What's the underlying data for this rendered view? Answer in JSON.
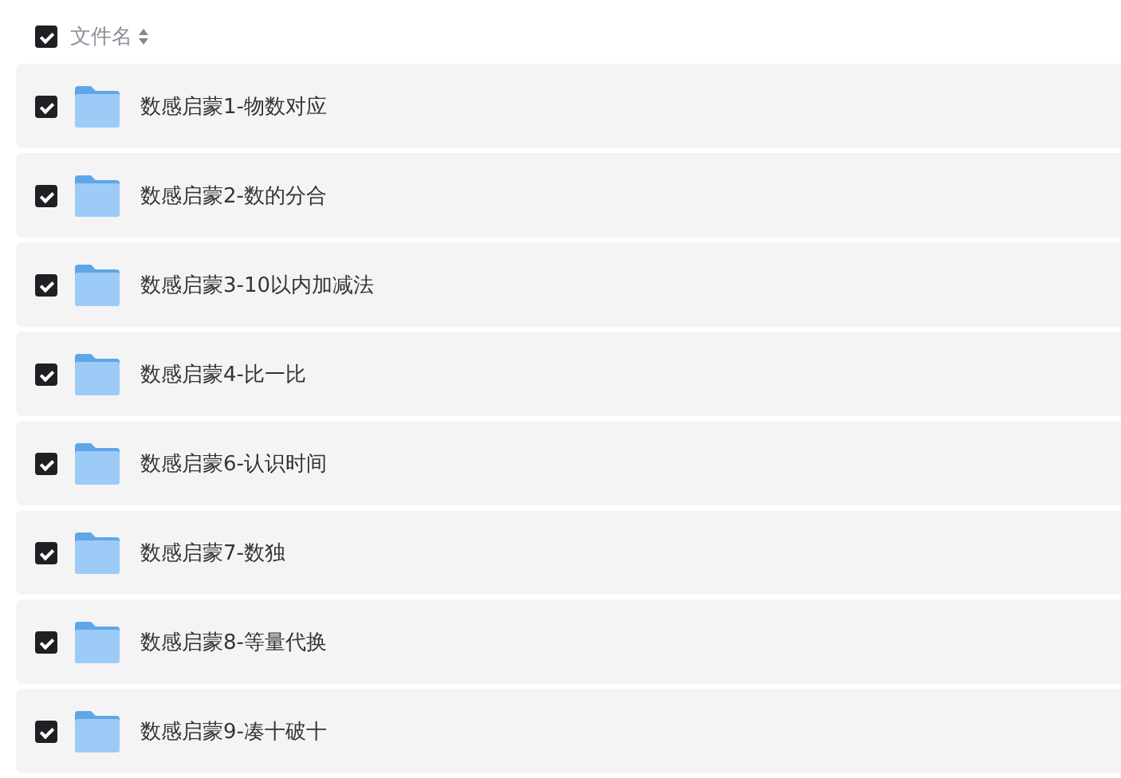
{
  "header": {
    "checked": true,
    "label": "文件名"
  },
  "files": [
    {
      "name": "数感启蒙1-物数对应",
      "checked": true
    },
    {
      "name": "数感启蒙2-数的分合",
      "checked": true
    },
    {
      "name": "数感启蒙3-10以内加减法",
      "checked": true
    },
    {
      "name": "数感启蒙4-比一比",
      "checked": true
    },
    {
      "name": "数感启蒙6-认识时间",
      "checked": true
    },
    {
      "name": "数感启蒙7-数独",
      "checked": true
    },
    {
      "name": "数感启蒙8-等量代换",
      "checked": true
    },
    {
      "name": "数感启蒙9-凑十破十",
      "checked": true
    }
  ]
}
